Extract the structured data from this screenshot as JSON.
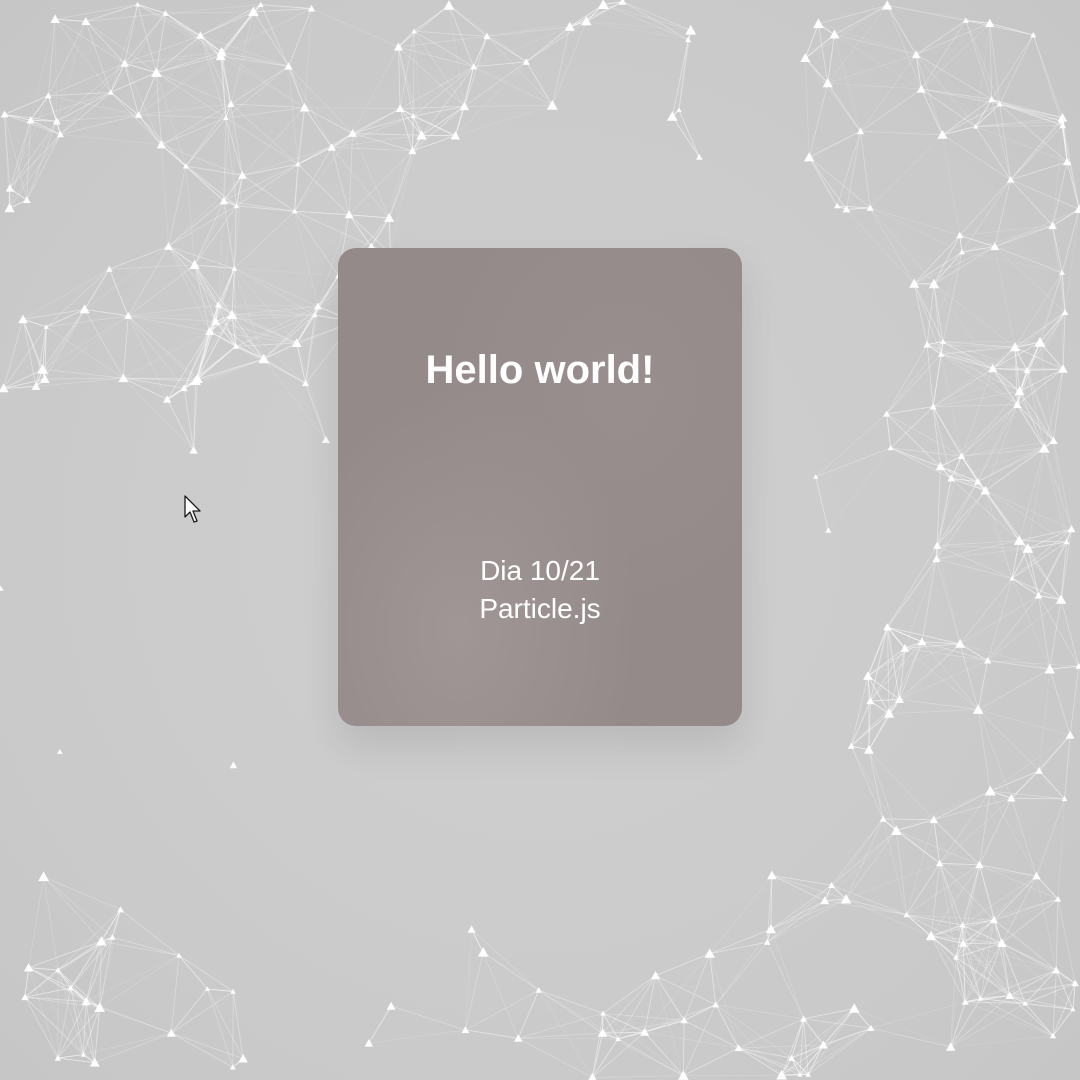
{
  "card": {
    "title": "Hello world!",
    "line1": "Dia 10/21",
    "line2": "Particle.js"
  },
  "colors": {
    "background": "#cbcbcb",
    "card": "#948a8a",
    "particles": "#ffffff",
    "text": "#ffffff"
  },
  "icons": {
    "cursor": "mouse-pointer-icon"
  }
}
